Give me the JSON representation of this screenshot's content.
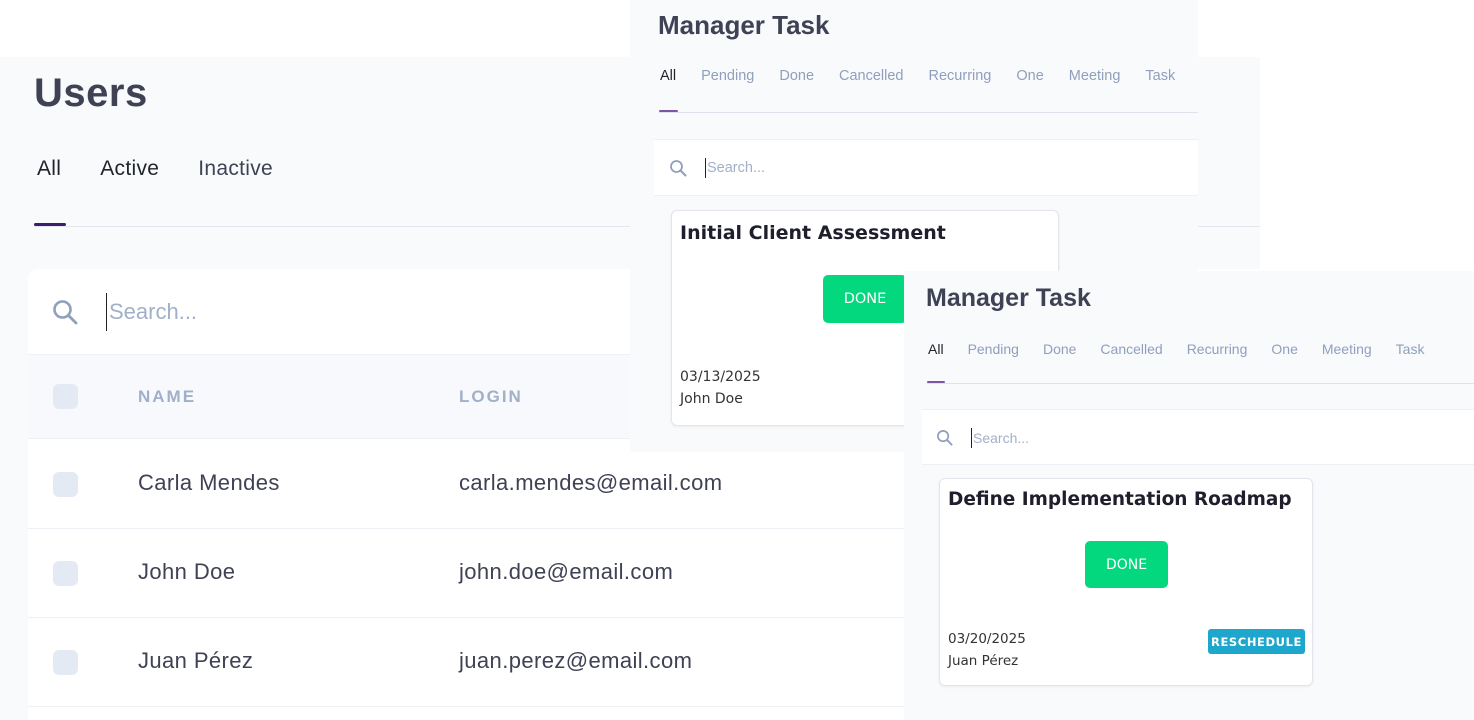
{
  "users": {
    "title": "Users",
    "tabs": [
      "All",
      "Active",
      "Inactive"
    ],
    "search_placeholder": "Search...",
    "columns": {
      "name": "NAME",
      "login": "LOGIN"
    },
    "rows": [
      {
        "name": "Carla Mendes",
        "login": "carla.mendes@email.com"
      },
      {
        "name": "John Doe",
        "login": "john.doe@email.com"
      },
      {
        "name": "Juan Pérez",
        "login": "juan.perez@email.com"
      }
    ]
  },
  "task_panel_1": {
    "title": "Manager Task",
    "tabs": [
      "All",
      "Pending",
      "Done",
      "Cancelled",
      "Recurring",
      "One",
      "Meeting",
      "Task"
    ],
    "search_placeholder": "Search...",
    "card": {
      "title": "Initial Client Assessment",
      "status_button": "DONE",
      "date": "03/13/2025",
      "owner": "John Doe"
    }
  },
  "task_panel_2": {
    "title": "Manager Task",
    "tabs": [
      "All",
      "Pending",
      "Done",
      "Cancelled",
      "Recurring",
      "One",
      "Meeting",
      "Task"
    ],
    "search_placeholder": "Search...",
    "card": {
      "title": "Define Implementation Roadmap",
      "status_button": "DONE",
      "date": "03/20/2025",
      "owner": "Juan Pérez",
      "reschedule_button": "RESCHEDULE"
    }
  },
  "colors": {
    "done_green": "#03d87f",
    "reschedule_blue": "#1ea7cc",
    "active_tab_underline": "#3b1d6b"
  },
  "icons": {
    "search": "search-icon"
  }
}
